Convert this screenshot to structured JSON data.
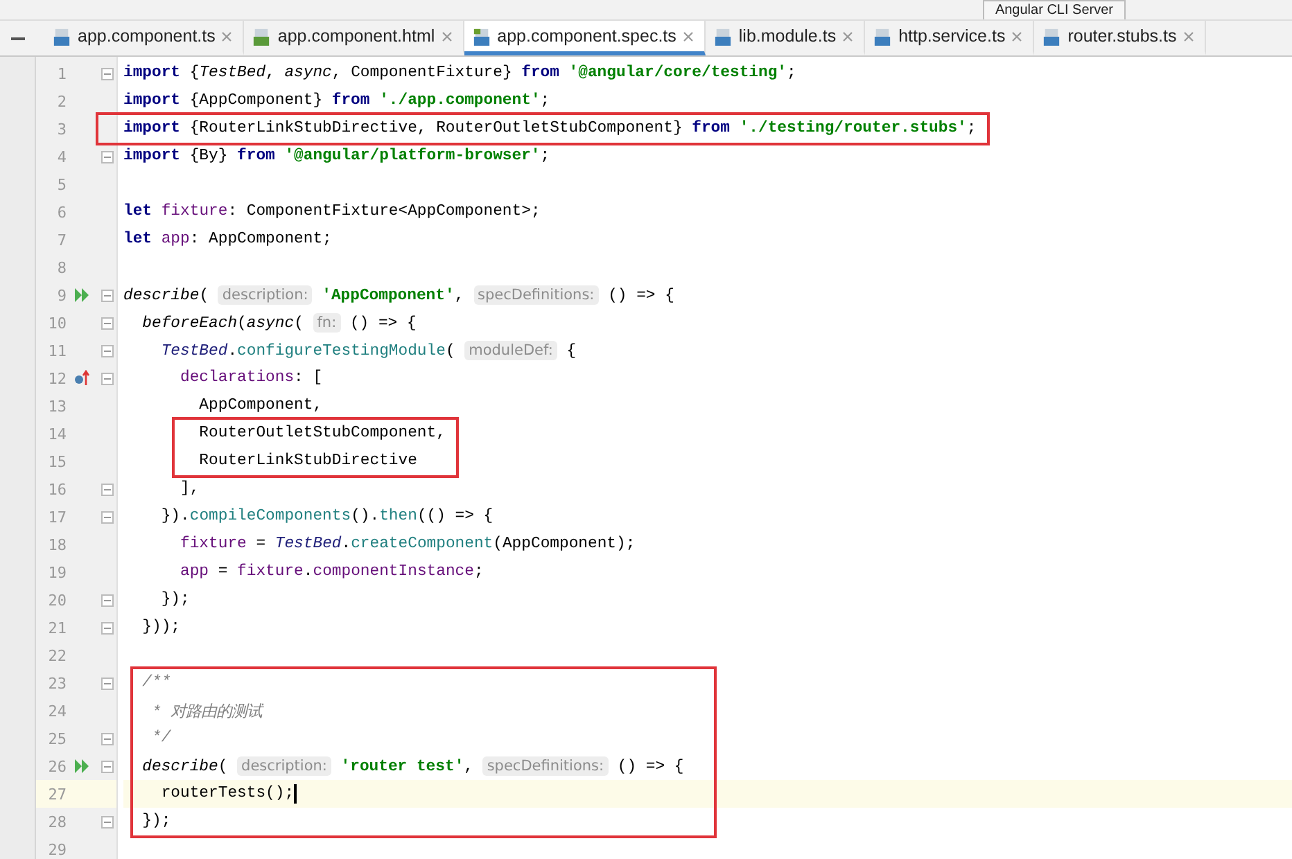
{
  "toolbar": {
    "run_config": "Angular CLI Server"
  },
  "tabs": [
    {
      "label": "app.component.ts",
      "kind": "ts",
      "selected": false
    },
    {
      "label": "app.component.html",
      "kind": "html",
      "selected": false
    },
    {
      "label": "app.component.spec.ts",
      "kind": "spec",
      "selected": true
    },
    {
      "label": "lib.module.ts",
      "kind": "ts",
      "selected": false
    },
    {
      "label": "http.service.ts",
      "kind": "ts",
      "selected": false
    },
    {
      "label": "router.stubs.ts",
      "kind": "ts",
      "selected": false
    }
  ],
  "editor": {
    "lines": [
      {
        "number": "1",
        "fold": true,
        "runnable": false,
        "overridden": false,
        "boxed": false,
        "current": false,
        "tokens": [
          {
            "kind": "kw",
            "text": "import"
          },
          {
            "kind": "plain",
            "text": " {"
          },
          {
            "kind": "ital",
            "text": "TestBed"
          },
          {
            "kind": "plain",
            "text": ", "
          },
          {
            "kind": "ital",
            "text": "async"
          },
          {
            "kind": "plain",
            "text": ", ComponentFixture} "
          },
          {
            "kind": "kw",
            "text": "from"
          },
          {
            "kind": "str",
            "text": " '@angular/core/testing'"
          },
          {
            "kind": "plain",
            "text": ";"
          }
        ]
      },
      {
        "number": "2",
        "fold": false,
        "runnable": false,
        "overridden": false,
        "boxed": false,
        "current": false,
        "tokens": [
          {
            "kind": "kw",
            "text": "import"
          },
          {
            "kind": "plain",
            "text": " {AppComponent} "
          },
          {
            "kind": "kw",
            "text": "from"
          },
          {
            "kind": "str",
            "text": " './app.component'"
          },
          {
            "kind": "plain",
            "text": ";"
          }
        ]
      },
      {
        "number": "3",
        "fold": false,
        "runnable": false,
        "overridden": false,
        "boxed": true,
        "current": false,
        "tokens": [
          {
            "kind": "kw",
            "text": "import"
          },
          {
            "kind": "plain",
            "text": " {RouterLinkStubDirective, RouterOutletStubComponent} "
          },
          {
            "kind": "kw",
            "text": "from"
          },
          {
            "kind": "str",
            "text": " './testing/router.stubs'"
          },
          {
            "kind": "plain",
            "text": ";"
          }
        ]
      },
      {
        "number": "4",
        "fold": true,
        "runnable": false,
        "overridden": false,
        "boxed": false,
        "current": false,
        "tokens": [
          {
            "kind": "kw",
            "text": "import"
          },
          {
            "kind": "plain",
            "text": " {By} "
          },
          {
            "kind": "kw",
            "text": "from"
          },
          {
            "kind": "str",
            "text": " '@angular/platform-browser'"
          },
          {
            "kind": "plain",
            "text": ";"
          }
        ]
      },
      {
        "number": "5",
        "fold": false,
        "runnable": false,
        "overridden": false,
        "boxed": false,
        "current": false
      },
      {
        "number": "6",
        "fold": false,
        "runnable": false,
        "overridden": false,
        "boxed": false,
        "current": false,
        "tokens": [
          {
            "kind": "kw",
            "text": "let"
          },
          {
            "kind": "field",
            "text": " fixture"
          },
          {
            "kind": "plain",
            "text": ": ComponentFixture<AppComponent>;"
          }
        ]
      },
      {
        "number": "7",
        "fold": false,
        "runnable": false,
        "overridden": false,
        "boxed": false,
        "current": false,
        "tokens": [
          {
            "kind": "kw",
            "text": "let"
          },
          {
            "kind": "field",
            "text": " app"
          },
          {
            "kind": "plain",
            "text": ": AppComponent;"
          }
        ]
      },
      {
        "number": "8",
        "fold": false,
        "runnable": false,
        "overridden": false,
        "boxed": false,
        "current": false
      },
      {
        "number": "9",
        "fold": true,
        "runnable": true,
        "overridden": false,
        "boxed": false,
        "current": false,
        "tokens": [
          {
            "kind": "ital",
            "text": "describe"
          },
          {
            "kind": "plain",
            "text": "( "
          },
          {
            "kind": "hint",
            "text": "description:"
          },
          {
            "kind": "str",
            "text": " 'AppComponent'"
          },
          {
            "kind": "plain",
            "text": ", "
          },
          {
            "kind": "hint",
            "text": "specDefinitions:"
          },
          {
            "kind": "plain",
            "text": " () => {"
          }
        ]
      },
      {
        "number": "10",
        "fold": true,
        "runnable": false,
        "overridden": false,
        "boxed": false,
        "current": false,
        "tokens": [
          {
            "kind": "ital",
            "text": "  beforeEach"
          },
          {
            "kind": "plain",
            "text": "("
          },
          {
            "kind": "ital",
            "text": "async"
          },
          {
            "kind": "plain",
            "text": "( "
          },
          {
            "kind": "hint",
            "text": "fn:"
          },
          {
            "kind": "plain",
            "text": " () => {"
          }
        ]
      },
      {
        "number": "11",
        "fold": true,
        "runnable": false,
        "overridden": false,
        "boxed": false,
        "current": false,
        "tokens": [
          {
            "kind": "cls",
            "text": "    TestBed"
          },
          {
            "kind": "plain",
            "text": "."
          },
          {
            "kind": "fn",
            "text": "configureTestingModule"
          },
          {
            "kind": "plain",
            "text": "( "
          },
          {
            "kind": "hint",
            "text": "moduleDef:"
          },
          {
            "kind": "plain",
            "text": " {"
          }
        ]
      },
      {
        "number": "12",
        "fold": true,
        "runnable": false,
        "overridden": true,
        "boxed": false,
        "current": false,
        "tokens": [
          {
            "kind": "field",
            "text": "      declarations"
          },
          {
            "kind": "plain",
            "text": ": ["
          }
        ]
      },
      {
        "number": "13",
        "fold": false,
        "runnable": false,
        "overridden": false,
        "boxed": false,
        "current": false,
        "tokens": [
          {
            "kind": "plain",
            "text": "        AppComponent,"
          }
        ]
      },
      {
        "number": "14",
        "fold": false,
        "runnable": false,
        "overridden": false,
        "boxed": true,
        "current": false,
        "tokens": [
          {
            "kind": "plain",
            "text": "        RouterOutletStubComponent,"
          }
        ]
      },
      {
        "number": "15",
        "fold": false,
        "runnable": false,
        "overridden": false,
        "boxed": true,
        "current": false,
        "tokens": [
          {
            "kind": "plain",
            "text": "        RouterLinkStubDirective"
          }
        ]
      },
      {
        "number": "16",
        "fold": true,
        "runnable": false,
        "overridden": false,
        "boxed": false,
        "current": false,
        "tokens": [
          {
            "kind": "plain",
            "text": "      ],"
          }
        ]
      },
      {
        "number": "17",
        "fold": true,
        "runnable": false,
        "overridden": false,
        "boxed": false,
        "current": false,
        "tokens": [
          {
            "kind": "plain",
            "text": "    })."
          },
          {
            "kind": "fn",
            "text": "compileComponents"
          },
          {
            "kind": "plain",
            "text": "()."
          },
          {
            "kind": "fn",
            "text": "then"
          },
          {
            "kind": "plain",
            "text": "(() => {"
          }
        ]
      },
      {
        "number": "18",
        "fold": false,
        "runnable": false,
        "overridden": false,
        "boxed": false,
        "current": false,
        "tokens": [
          {
            "kind": "field",
            "text": "      fixture"
          },
          {
            "kind": "plain",
            "text": " = "
          },
          {
            "kind": "cls",
            "text": "TestBed"
          },
          {
            "kind": "plain",
            "text": "."
          },
          {
            "kind": "fn",
            "text": "createComponent"
          },
          {
            "kind": "plain",
            "text": "(AppComponent);"
          }
        ]
      },
      {
        "number": "19",
        "fold": false,
        "runnable": false,
        "overridden": false,
        "boxed": false,
        "current": false,
        "tokens": [
          {
            "kind": "field",
            "text": "      app"
          },
          {
            "kind": "plain",
            "text": " = "
          },
          {
            "kind": "field",
            "text": "fixture"
          },
          {
            "kind": "plain",
            "text": "."
          },
          {
            "kind": "field",
            "text": "componentInstance"
          },
          {
            "kind": "plain",
            "text": ";"
          }
        ]
      },
      {
        "number": "20",
        "fold": true,
        "runnable": false,
        "overridden": false,
        "boxed": false,
        "current": false,
        "tokens": [
          {
            "kind": "plain",
            "text": "    });"
          }
        ]
      },
      {
        "number": "21",
        "fold": true,
        "runnable": false,
        "overridden": false,
        "boxed": false,
        "current": false,
        "tokens": [
          {
            "kind": "plain",
            "text": "  }));"
          }
        ]
      },
      {
        "number": "22",
        "fold": false,
        "runnable": false,
        "overridden": false,
        "boxed": false,
        "current": false
      },
      {
        "number": "23",
        "fold": true,
        "runnable": false,
        "overridden": false,
        "boxed": true,
        "current": false,
        "tokens": [
          {
            "kind": "comment",
            "text": "  /**"
          }
        ]
      },
      {
        "number": "24",
        "fold": false,
        "runnable": false,
        "overridden": false,
        "boxed": true,
        "current": false,
        "tokens": [
          {
            "kind": "comment",
            "text": "   * 对路由的测试"
          }
        ]
      },
      {
        "number": "25",
        "fold": true,
        "runnable": false,
        "overridden": false,
        "boxed": true,
        "current": false,
        "tokens": [
          {
            "kind": "comment",
            "text": "   */"
          }
        ]
      },
      {
        "number": "26",
        "fold": true,
        "runnable": true,
        "overridden": false,
        "boxed": true,
        "current": false,
        "tokens": [
          {
            "kind": "ital",
            "text": "  describe"
          },
          {
            "kind": "plain",
            "text": "( "
          },
          {
            "kind": "hint",
            "text": "description:"
          },
          {
            "kind": "str",
            "text": " 'router test'"
          },
          {
            "kind": "plain",
            "text": ", "
          },
          {
            "kind": "hint",
            "text": "specDefinitions:"
          },
          {
            "kind": "plain",
            "text": " () => {"
          }
        ]
      },
      {
        "number": "27",
        "fold": false,
        "runnable": false,
        "overridden": false,
        "boxed": true,
        "current": true,
        "tokens": [
          {
            "kind": "plain",
            "text": "    routerTests();"
          }
        ]
      },
      {
        "number": "28",
        "fold": true,
        "runnable": false,
        "overridden": false,
        "boxed": true,
        "current": false,
        "tokens": [
          {
            "kind": "plain",
            "text": "  });"
          }
        ]
      },
      {
        "number": "29",
        "fold": false,
        "runnable": false,
        "overridden": false,
        "boxed": false,
        "current": false
      }
    ]
  }
}
